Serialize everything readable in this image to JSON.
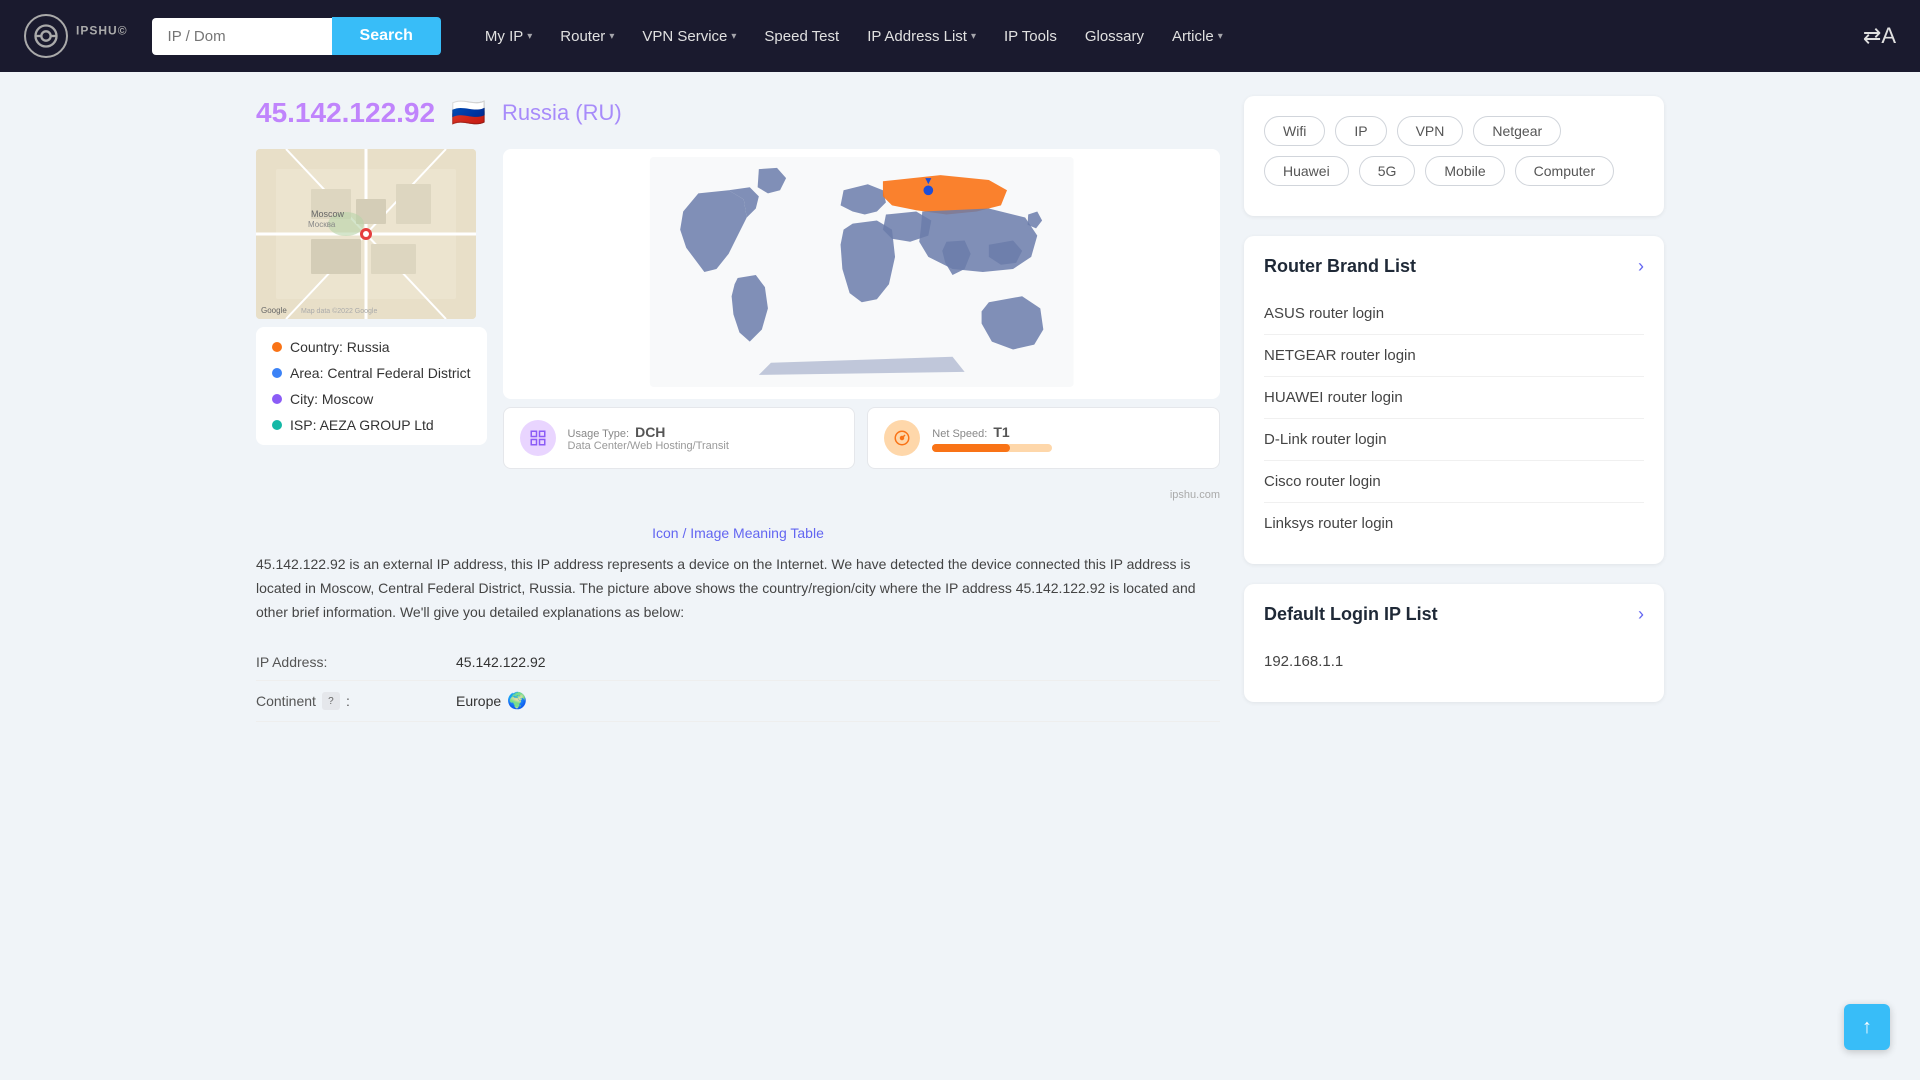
{
  "header": {
    "logo_text": "IPSHU",
    "logo_sup": "©",
    "search_placeholder": "IP / Dom",
    "search_btn": "Search",
    "nav_items": [
      {
        "label": "My IP",
        "has_dropdown": true
      },
      {
        "label": "Router",
        "has_dropdown": true
      },
      {
        "label": "VPN Service",
        "has_dropdown": true
      },
      {
        "label": "Speed Test",
        "has_dropdown": false
      },
      {
        "label": "IP Address List",
        "has_dropdown": true
      },
      {
        "label": "IP Tools",
        "has_dropdown": false
      },
      {
        "label": "Glossary",
        "has_dropdown": false
      },
      {
        "label": "Article",
        "has_dropdown": true
      }
    ]
  },
  "main": {
    "ip_address": "45.142.122.92",
    "country_name": "Russia (RU)",
    "flag": "🇷🇺",
    "info_rows": [
      {
        "color": "orange",
        "label": "Country: Russia"
      },
      {
        "color": "blue",
        "label": "Area: Central Federal District"
      },
      {
        "color": "purple",
        "label": "City: Moscow"
      },
      {
        "color": "teal",
        "label": "ISP: AEZA GROUP Ltd"
      }
    ],
    "usage_type": {
      "label": "Usage Type:",
      "value": "DCH",
      "sub": "Data Center/Web Hosting/Transit"
    },
    "net_speed": {
      "label": "Net Speed:",
      "value": "T1",
      "bar_percent": 65
    },
    "watermark": "ipshu.com",
    "icon_table_link": "Icon / Image Meaning Table",
    "description": "45.142.122.92 is an external IP address, this IP address represents a device on the Internet. We have detected the device connected this IP address is located in Moscow, Central Federal District, Russia. The picture above shows the country/region/city where the IP address 45.142.122.92 is located and other brief information. We'll give you detailed explanations as below:",
    "details": [
      {
        "label": "IP Address:",
        "value": "45.142.122.92",
        "has_help": false,
        "has_globe": false
      },
      {
        "label": "Continent",
        "value": "Europe",
        "has_help": true,
        "has_globe": true
      }
    ]
  },
  "sidebar": {
    "tags": [
      {
        "label": "Wifi"
      },
      {
        "label": "IP"
      },
      {
        "label": "VPN"
      },
      {
        "label": "Netgear"
      },
      {
        "label": "Huawei"
      },
      {
        "label": "5G"
      },
      {
        "label": "Mobile"
      },
      {
        "label": "Computer"
      }
    ],
    "router_brand_list": {
      "title": "Router Brand List",
      "items": [
        "ASUS router login",
        "NETGEAR router login",
        "HUAWEI router login",
        "D-Link router login",
        "Cisco router login",
        "Linksys router login"
      ]
    },
    "default_login_ip_list": {
      "title": "Default Login IP List",
      "items": [
        "192.168.1.1"
      ]
    }
  }
}
